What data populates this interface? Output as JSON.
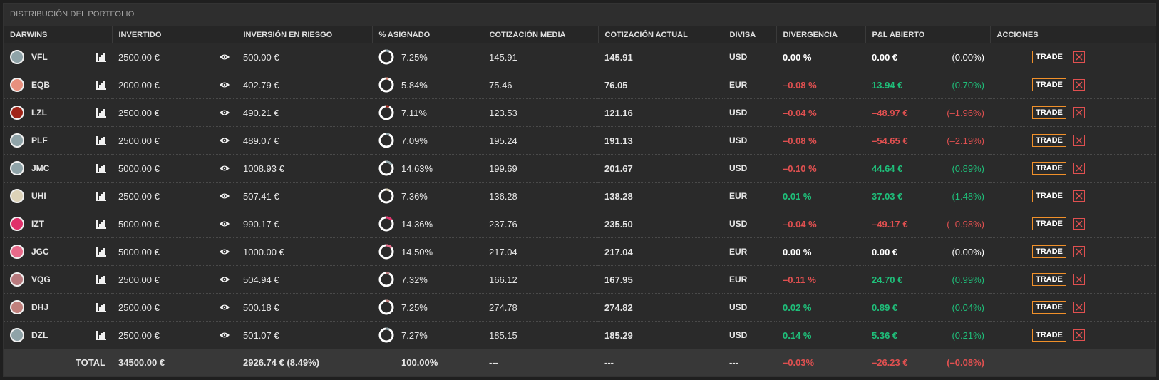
{
  "panel": {
    "title": "DISTRIBUCIÓN DEL PORTFOLIO"
  },
  "columns": {
    "darwins": "DARWINS",
    "invertido": "INVERTIDO",
    "riesgo": "INVERSIÓN EN RIESGO",
    "asignado": "% ASIGNADO",
    "media": "COTIZACIÓN MEDIA",
    "actual": "COTIZACIÓN ACTUAL",
    "divisa": "DIVISA",
    "divergencia": "DIVERGENCIA",
    "pl": "P&L ABIERTO",
    "acciones": "ACCIONES"
  },
  "trade_label": "TRADE",
  "rows": [
    {
      "name": "VFL",
      "color": "#8fa3a8",
      "invested": "2500.00 €",
      "risk": "500.00 €",
      "alloc": "7.25%",
      "alloc_frac": 0.0725,
      "avg": "145.91",
      "current": "145.91",
      "currency": "USD",
      "div": "0.00 %",
      "div_class": "neutral",
      "pl": "0.00 €",
      "pl_pct": "(0.00%)",
      "pl_class": "neutral"
    },
    {
      "name": "EQB",
      "color": "#e8907e",
      "invested": "2000.00 €",
      "risk": "402.79 €",
      "alloc": "5.84%",
      "alloc_frac": 0.0584,
      "avg": "75.46",
      "current": "76.05",
      "currency": "EUR",
      "div": "–0.08 %",
      "div_class": "neg",
      "pl": "13.94 €",
      "pl_pct": "(0.70%)",
      "pl_class": "pos"
    },
    {
      "name": "LZL",
      "color": "#a02418",
      "invested": "2500.00 €",
      "risk": "490.21 €",
      "alloc": "7.11%",
      "alloc_frac": 0.0711,
      "avg": "123.53",
      "current": "121.16",
      "currency": "USD",
      "div": "–0.04 %",
      "div_class": "neg",
      "pl": "–48.97 €",
      "pl_pct": "(–1.96%)",
      "pl_class": "neg"
    },
    {
      "name": "PLF",
      "color": "#8fa3a8",
      "invested": "2500.00 €",
      "risk": "489.07 €",
      "alloc": "7.09%",
      "alloc_frac": 0.0709,
      "avg": "195.24",
      "current": "191.13",
      "currency": "USD",
      "div": "–0.08 %",
      "div_class": "neg",
      "pl": "–54.65 €",
      "pl_pct": "(–2.19%)",
      "pl_class": "neg"
    },
    {
      "name": "JMC",
      "color": "#8fa3a8",
      "invested": "5000.00 €",
      "risk": "1008.93 €",
      "alloc": "14.63%",
      "alloc_frac": 0.1463,
      "avg": "199.69",
      "current": "201.67",
      "currency": "USD",
      "div": "–0.10 %",
      "div_class": "neg",
      "pl": "44.64 €",
      "pl_pct": "(0.89%)",
      "pl_class": "pos"
    },
    {
      "name": "UHI",
      "color": "#dcd2b8",
      "invested": "2500.00 €",
      "risk": "507.41 €",
      "alloc": "7.36%",
      "alloc_frac": 0.0736,
      "avg": "136.28",
      "current": "138.28",
      "currency": "EUR",
      "div": "0.01 %",
      "div_class": "pos",
      "pl": "37.03 €",
      "pl_pct": "(1.48%)",
      "pl_class": "pos"
    },
    {
      "name": "IZT",
      "color": "#e0306a",
      "invested": "5000.00 €",
      "risk": "990.17 €",
      "alloc": "14.36%",
      "alloc_frac": 0.1436,
      "avg": "237.76",
      "current": "235.50",
      "currency": "USD",
      "div": "–0.04 %",
      "div_class": "neg",
      "pl": "–49.17 €",
      "pl_pct": "(–0.98%)",
      "pl_class": "neg"
    },
    {
      "name": "JGC",
      "color": "#e86a8a",
      "invested": "5000.00 €",
      "risk": "1000.00 €",
      "alloc": "14.50%",
      "alloc_frac": 0.145,
      "avg": "217.04",
      "current": "217.04",
      "currency": "EUR",
      "div": "0.00 %",
      "div_class": "neutral",
      "pl": "0.00 €",
      "pl_pct": "(0.00%)",
      "pl_class": "neutral"
    },
    {
      "name": "VQG",
      "color": "#b87a7e",
      "invested": "2500.00 €",
      "risk": "504.94 €",
      "alloc": "7.32%",
      "alloc_frac": 0.0732,
      "avg": "166.12",
      "current": "167.95",
      "currency": "EUR",
      "div": "–0.11 %",
      "div_class": "neg",
      "pl": "24.70 €",
      "pl_pct": "(0.99%)",
      "pl_class": "pos"
    },
    {
      "name": "DHJ",
      "color": "#c0807c",
      "invested": "2500.00 €",
      "risk": "500.18 €",
      "alloc": "7.25%",
      "alloc_frac": 0.0725,
      "avg": "274.78",
      "current": "274.82",
      "currency": "USD",
      "div": "0.02 %",
      "div_class": "pos",
      "pl": "0.89 €",
      "pl_pct": "(0.04%)",
      "pl_class": "pos"
    },
    {
      "name": "DZL",
      "color": "#8fa3a8",
      "invested": "2500.00 €",
      "risk": "501.07 €",
      "alloc": "7.27%",
      "alloc_frac": 0.0727,
      "avg": "185.15",
      "current": "185.29",
      "currency": "USD",
      "div": "0.14 %",
      "div_class": "pos",
      "pl": "5.36 €",
      "pl_pct": "(0.21%)",
      "pl_class": "pos"
    }
  ],
  "total": {
    "label": "TOTAL",
    "invested": "34500.00 €",
    "risk": "2926.74 € (8.49%)",
    "alloc": "100.00%",
    "avg": "---",
    "current": "---",
    "currency": "---",
    "div": "–0.03%",
    "pl": "–26.23 €",
    "pl_pct": "(–0.08%)"
  }
}
